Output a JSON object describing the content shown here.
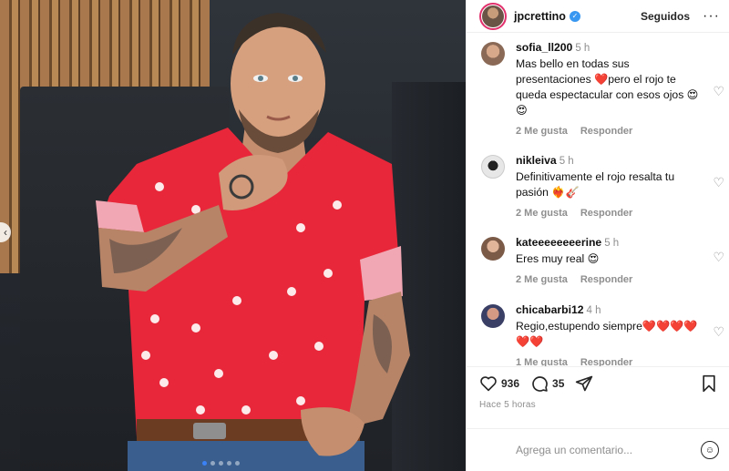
{
  "post_author": {
    "username": "jpcrettino",
    "follow_label": "Seguidos",
    "more_label": "···"
  },
  "comments": [
    {
      "username": "sofia_ll200",
      "time": "5 h",
      "text": "Mas bello en todas sus presentaciones ❤️pero el rojo te queda espectacular con esos ojos 😍😍",
      "likes": "2 Me gusta",
      "reply": "Responder"
    },
    {
      "username": "nikleiva",
      "time": "5 h",
      "text": "Definitivamente el rojo resalta tu pasión ❤️‍🔥🎸",
      "likes": "2 Me gusta",
      "reply": "Responder"
    },
    {
      "username": "kateeeeeeeerine",
      "time": "5 h",
      "text": "Eres muy real 😍",
      "likes": "2 Me gusta",
      "reply": "Responder"
    },
    {
      "username": "chicabarbi12",
      "time": "4 h",
      "text": "Regio,estupendo siempre❤️❤️❤️❤️❤️❤️",
      "likes": "1 Me gusta",
      "reply": "Responder"
    }
  ],
  "actions": {
    "likes_count": "936",
    "comments_count": "35",
    "posted_ago": "Hace 5 horas"
  },
  "add_comment": {
    "placeholder": "Agrega un comentario..."
  },
  "icons": {
    "like": "heart-icon",
    "comment": "comment-icon",
    "share": "send-icon",
    "save": "bookmark-icon",
    "emoji": "emoji-icon"
  },
  "colors": {
    "verified": "#3897f0",
    "shirt": "#e8283a"
  }
}
